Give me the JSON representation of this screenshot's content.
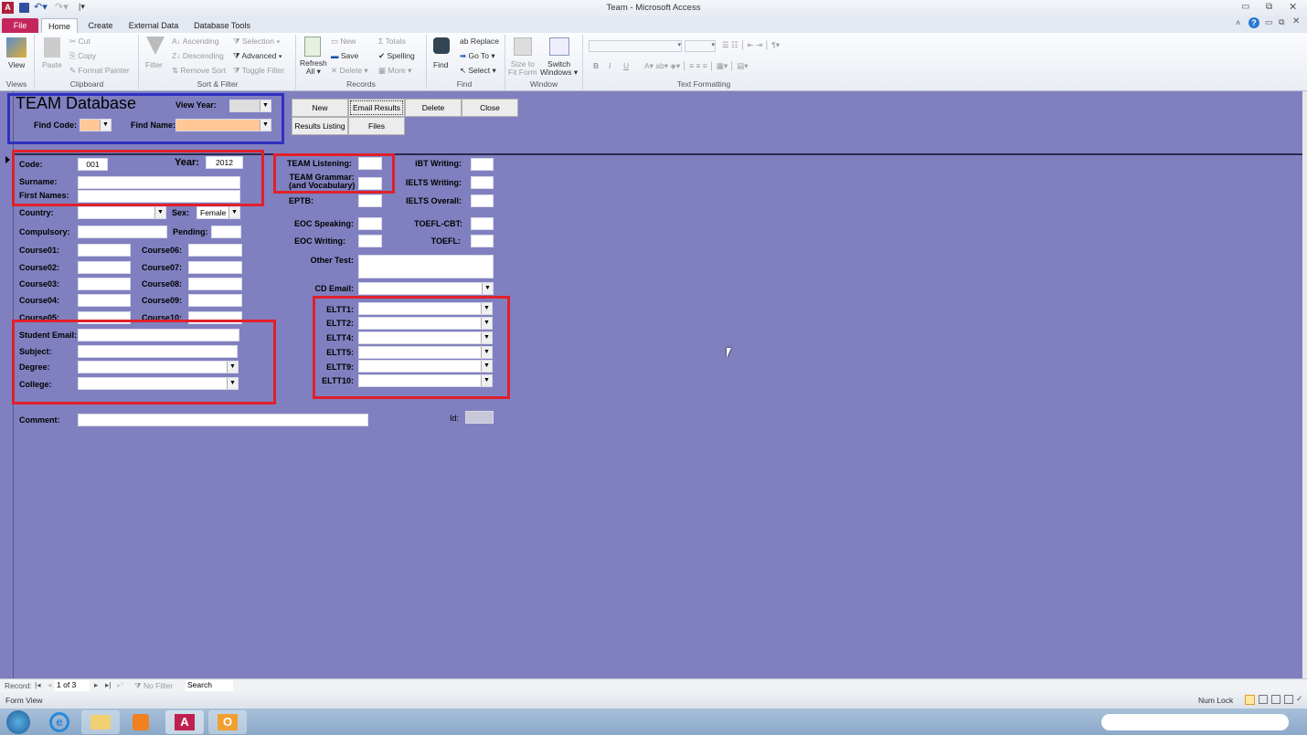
{
  "window": {
    "title": "Team - Microsoft Access"
  },
  "tabs": [
    "File",
    "Home",
    "Create",
    "External Data",
    "Database Tools"
  ],
  "ribbon": {
    "views": {
      "view": "View",
      "group": "Views"
    },
    "clipboard": {
      "paste": "Paste",
      "cut": "Cut",
      "copy": "Copy",
      "format_painter": "Format Painter",
      "group": "Clipboard"
    },
    "sort_filter": {
      "filter": "Filter",
      "ascending": "Ascending",
      "descending": "Descending",
      "remove_sort": "Remove Sort",
      "selection": "Selection",
      "advanced": "Advanced",
      "toggle_filter": "Toggle Filter",
      "group": "Sort & Filter"
    },
    "records": {
      "refresh": "Refresh",
      "refresh2": "All",
      "new": "New",
      "save": "Save",
      "delete": "Delete",
      "totals": "Totals",
      "spelling": "Spelling",
      "more": "More",
      "group": "Records"
    },
    "find": {
      "find": "Find",
      "replace": "Replace",
      "goto": "Go To",
      "select": "Select",
      "group": "Find"
    },
    "window": {
      "size_to_fit": "Size to",
      "size_to_fit2": "Fit Form",
      "switch": "Switch",
      "switch2": "Windows",
      "group": "Window"
    },
    "text_formatting": {
      "bold": "B",
      "italic": "I",
      "underline": "U",
      "group": "Text Formatting"
    }
  },
  "form": {
    "title": "TEAM Database",
    "view_year_label": "View Year:",
    "find_code_label": "Find Code:",
    "find_name_label": "Find Name:",
    "buttons": {
      "new": "New",
      "email_results": "Email Results",
      "delete": "Delete",
      "close": "Close",
      "results_listing": "Results Listing",
      "files": "Files"
    },
    "code_label": "Code:",
    "code_value": "001",
    "year_label": "Year:",
    "year_value": "2012",
    "surname_label": "Surname:",
    "first_names_label": "First Names:",
    "country_label": "Country:",
    "sex_label": "Sex:",
    "sex_value": "Female",
    "compulsory_label": "Compulsory:",
    "pending_label": "Pending:",
    "courses": [
      "Course01:",
      "Course02:",
      "Course03:",
      "Course04:",
      "Course05:",
      "Course06:",
      "Course07:",
      "Course08:",
      "Course09:",
      "Course10:"
    ],
    "student_email_label": "Student Email:",
    "subject_label": "Subject:",
    "degree_label": "Degree:",
    "college_label": "College:",
    "comment_label": "Comment:",
    "team_listening_label": "TEAM Listening:",
    "team_grammar_label": "TEAM Grammar:",
    "team_grammar_label2": "(and Vocabulary)",
    "eptb_label": "EPTB:",
    "eoc_speaking_label": "EOC Speaking:",
    "eoc_writing_label": "EOC Writing:",
    "other_test_label": "Other Test:",
    "cd_email_label": "CD Email:",
    "eltt": [
      "ELTT1:",
      "ELTT2:",
      "ELTT4:",
      "ELTT5:",
      "ELTT9:",
      "ELTT10:"
    ],
    "ibt_writing_label": "iBT Writing:",
    "ielts_writing_label": "IELTS Writing:",
    "ielts_overall_label": "IELTS Overall:",
    "toefl_cbt_label": "TOEFL-CBT:",
    "toefl_label": "TOEFL:",
    "id_label": "Id:"
  },
  "navigation": {
    "record_label": "Record:",
    "position": "1 of 3",
    "no_filter": "No Filter",
    "search": "Search"
  },
  "status": {
    "view": "Form View",
    "num_lock": "Num Lock"
  },
  "colors": {
    "form_bg": "#8080c0",
    "highlight_red": "#e0202a",
    "highlight_blue": "#3030c0",
    "find_field": "#ffc896",
    "file_tab": "#c3265d"
  }
}
